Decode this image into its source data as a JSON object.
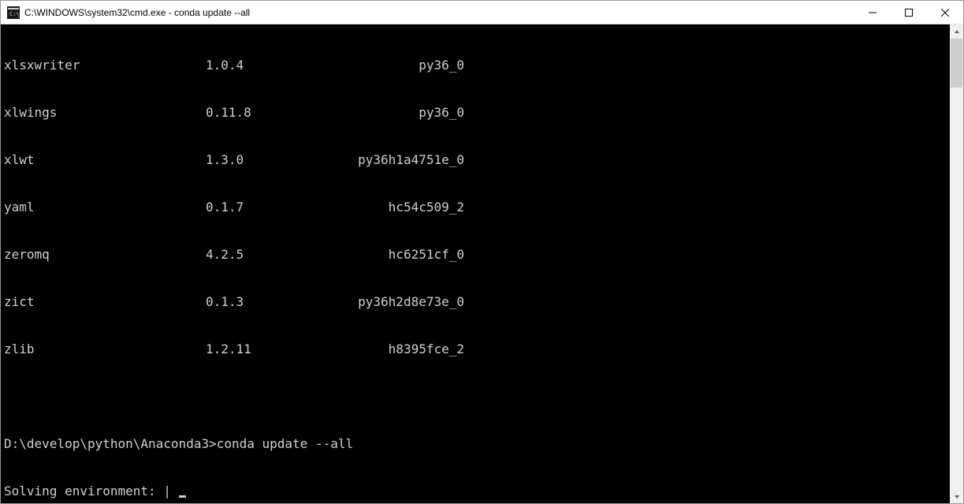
{
  "window": {
    "title": "C:\\WINDOWS\\system32\\cmd.exe - conda  update --all"
  },
  "packages": [
    {
      "name": "xlsxwriter",
      "version": "1.0.4",
      "build": "py36_0"
    },
    {
      "name": "xlwings",
      "version": "0.11.8",
      "build": "py36_0"
    },
    {
      "name": "xlwt",
      "version": "1.3.0",
      "build": "py36h1a4751e_0"
    },
    {
      "name": "yaml",
      "version": "0.1.7",
      "build": "hc54c509_2"
    },
    {
      "name": "zeromq",
      "version": "4.2.5",
      "build": "hc6251cf_0"
    },
    {
      "name": "zict",
      "version": "0.1.3",
      "build": "py36h2d8e73e_0"
    },
    {
      "name": "zlib",
      "version": "1.2.11",
      "build": "h8395fce_2"
    }
  ],
  "prompt": {
    "path": "D:\\develop\\python\\Anaconda3>",
    "command": "conda update --all"
  },
  "status": {
    "text": "Solving environment: | "
  }
}
